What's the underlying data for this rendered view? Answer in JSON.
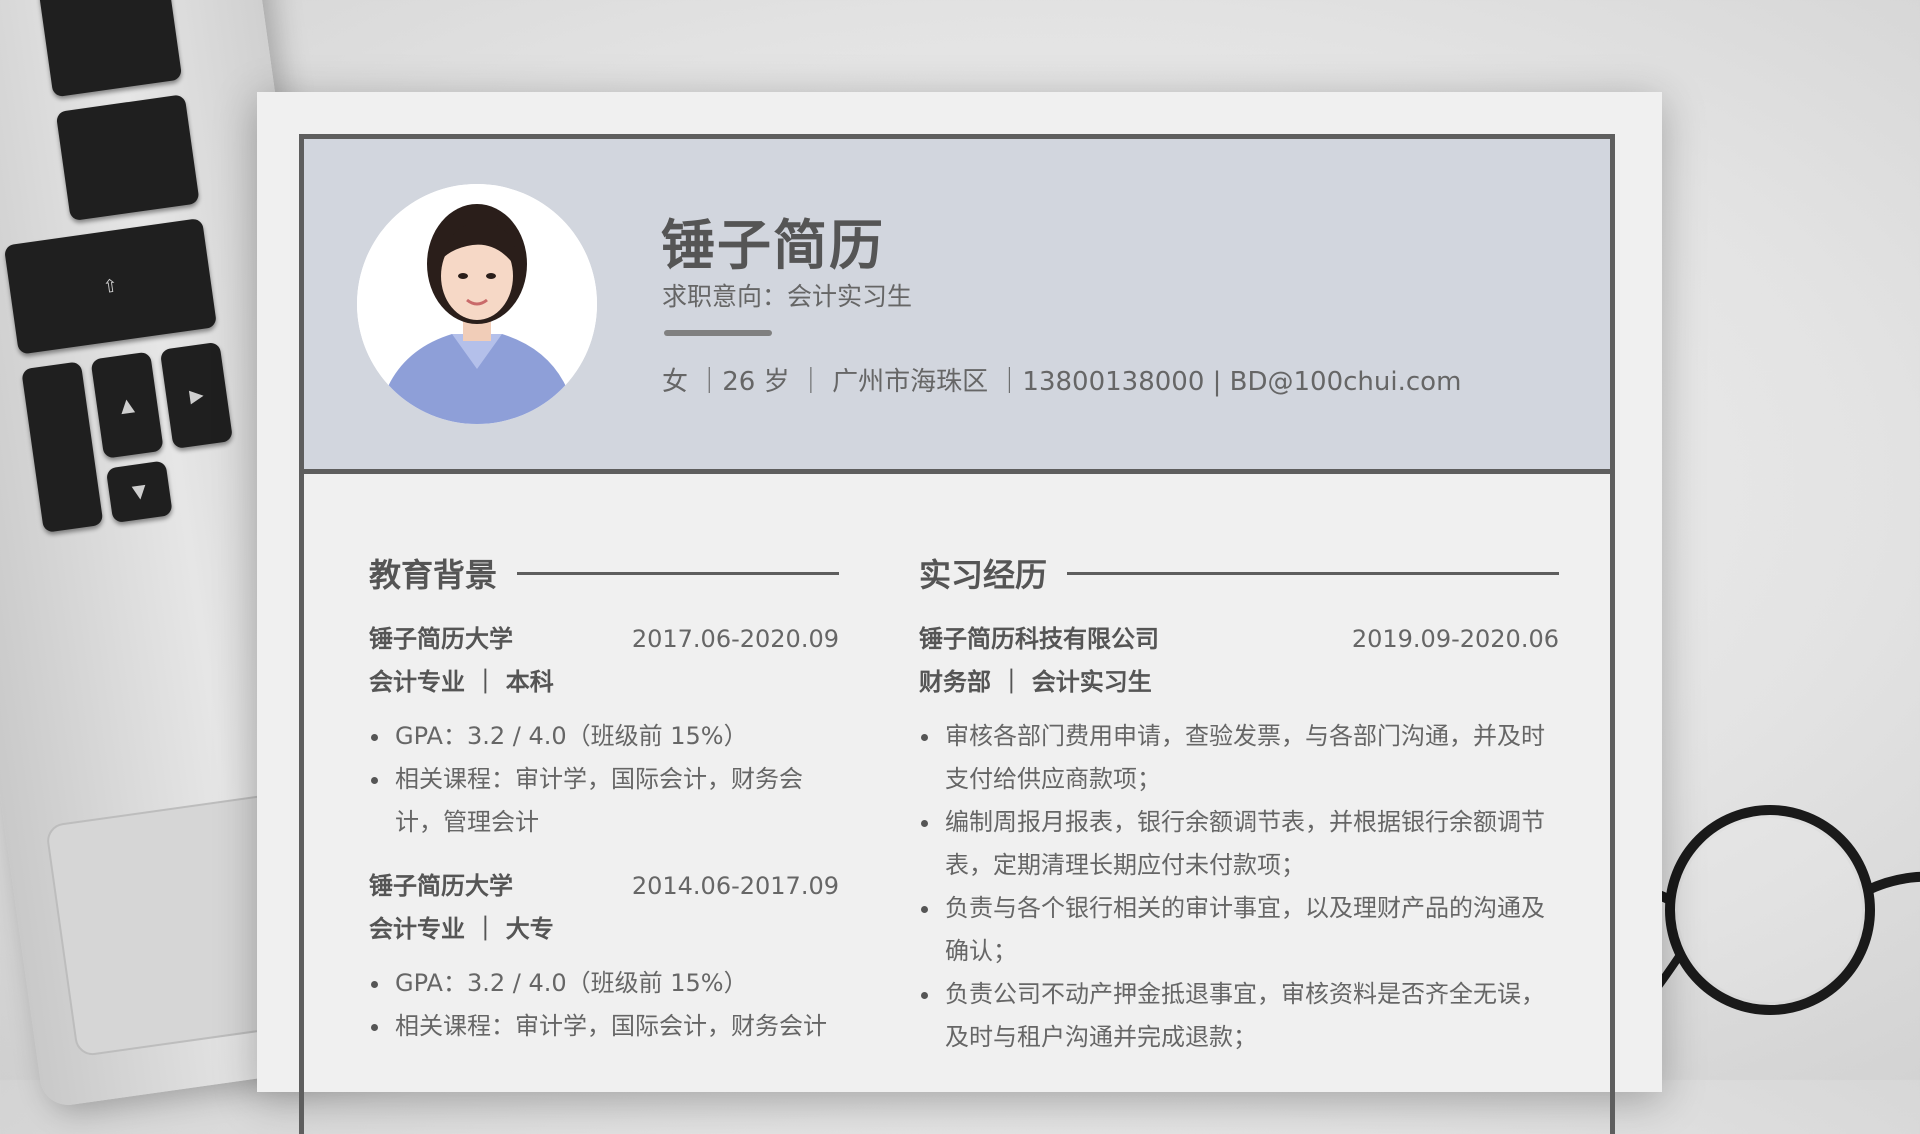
{
  "resume": {
    "name": "锤子简历",
    "intent": "求职意向：会计实习生",
    "contact": "女 ｜26 岁 ｜ 广州市海珠区 ｜13800138000 | BD@100chui.com"
  },
  "education": {
    "title": "教育背景",
    "entries": [
      {
        "school": "锤子简历大学",
        "date": "2017.06-2020.09",
        "major": "会计专业 ｜ 本科",
        "bullets": [
          "GPA：3.2 / 4.0（班级前 15%）",
          "相关课程：审计学，国际会计，财务会计，管理会计"
        ]
      },
      {
        "school": "锤子简历大学",
        "date": "2014.06-2017.09",
        "major": "会计专业 ｜ 大专",
        "bullets": [
          "GPA：3.2 / 4.0（班级前 15%）",
          "相关课程：审计学，国际会计，财务会计"
        ]
      }
    ]
  },
  "internship": {
    "title": "实习经历",
    "entries": [
      {
        "company": "锤子简历科技有限公司",
        "date": "2019.09-2020.06",
        "role": "财务部 ｜ 会计实习生",
        "bullets": [
          "审核各部门费用申请，查验发票，与各部门沟通，并及时支付给供应商款项；",
          "编制周报月报表，银行余额调节表，并根据银行余额调节表，定期清理长期应付未付款项；",
          "负责与各个银行相关的审计事宜，以及理财产品的沟通及确认；",
          "负责公司不动产押金抵退事宜，审核资料是否齐全无误，及时与租户沟通并完成退款；"
        ]
      }
    ]
  },
  "icons": {
    "avatar": "portrait-photo",
    "decor_left": "laptop-keyboard",
    "decor_right": "glasses"
  }
}
